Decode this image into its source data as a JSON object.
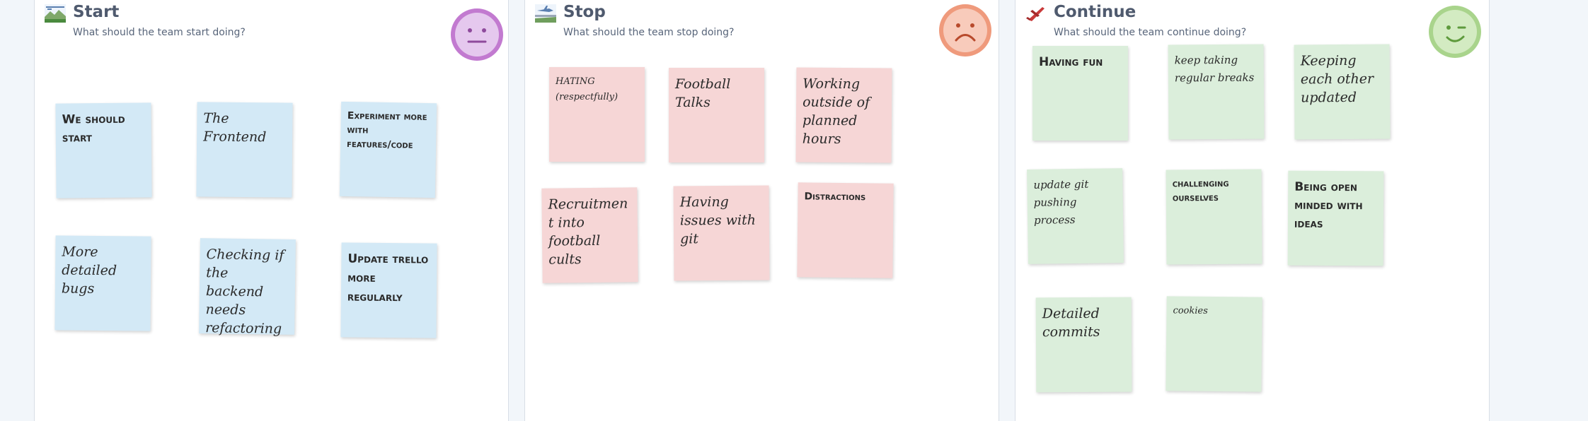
{
  "columns": {
    "start": {
      "title": "Start",
      "subtitle": "What should the team start doing?",
      "face_color": "#c27ad0",
      "face_fill": "#e5c8ee",
      "notes": [
        "We should start",
        "The Frontend",
        "Experiment more with features/code",
        "More detailed bugs",
        "Checking if the backend needs refactoring",
        "Update trello more regularly"
      ]
    },
    "stop": {
      "title": "Stop",
      "subtitle": "What should the team stop doing?",
      "face_color": "#ef9a7c",
      "face_fill": "#f8cbbb",
      "notes": [
        "HATING (respectfully)",
        "Football Talks",
        "Working outside of planned hours",
        "Recruitment into football cults",
        "Having issues with git",
        "Distractions"
      ]
    },
    "continue": {
      "title": "Continue",
      "subtitle": "What should the team continue doing?",
      "face_color": "#a9d48c",
      "face_fill": "#d3ebc2",
      "notes": [
        "Having fun",
        "keep taking regular breaks",
        "Keeping each other updated",
        "update git pushing process",
        "challenging ourselves",
        "Being open minded with ideas",
        "Detailed commits",
        "cookies"
      ]
    }
  },
  "colors": {
    "blue_note": "#d3e9f6",
    "pink_note": "#f6d6d6",
    "green_note": "#dbeedb"
  },
  "icons": {
    "start": "landscape-icon",
    "stop": "airport-icon",
    "continue": "airplane-icon"
  }
}
